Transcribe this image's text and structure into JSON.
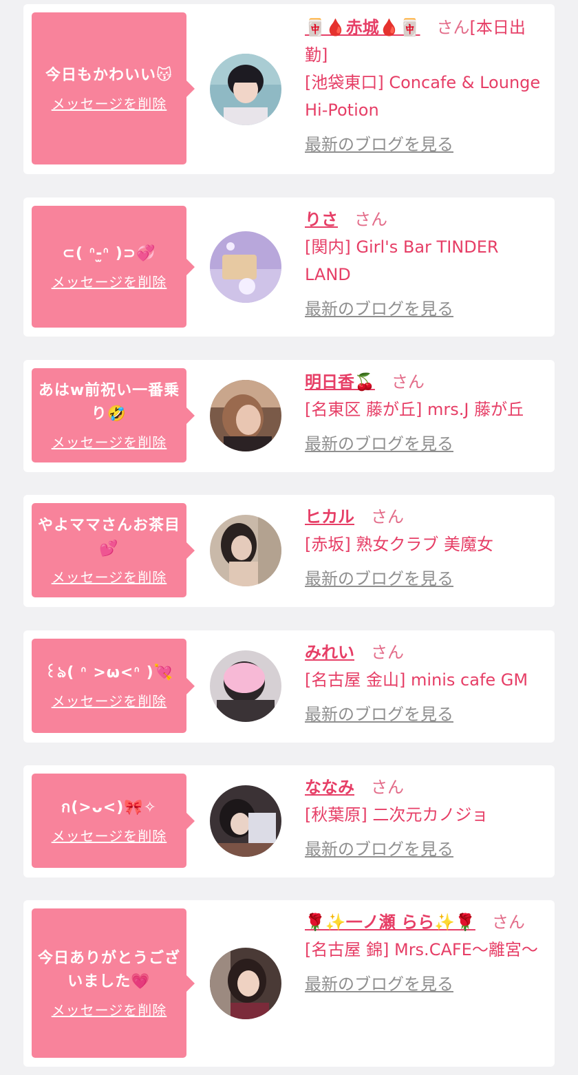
{
  "delete_label": "メッセージを削除",
  "blog_label": "最新のブログを見る",
  "honorific": "さん",
  "colors": {
    "accent": "#e63e66",
    "bubble": "#f8839b",
    "background": "#f1f1f3",
    "card": "#ffffff",
    "blog_link": "#8f8f8f"
  },
  "messages": [
    {
      "message": "今日もかわいい😽",
      "name": "🀄🩸赤城🩸🀄",
      "suffix": "[本日出勤]",
      "shop": "[池袋東口] Concafe & Lounge Hi-Potion"
    },
    {
      "message": "⊂( ᐢ-̫ᐢ )⊃💞",
      "name": "りさ",
      "suffix": "",
      "shop": "[関内] Girl's Bar TINDER LAND"
    },
    {
      "message": "あはw前祝い一番乗り🤣",
      "name": "明日香🍒",
      "suffix": "",
      "shop": "[名東区 藤が丘] mrs.J 藤が丘"
    },
    {
      "message": "やよママさんお茶目💕",
      "name": "ヒカル",
      "suffix": "",
      "shop": "[赤坂] 熟女クラブ 美魔女"
    },
    {
      "message": "꒰ঌ( ᐢ >ω<ᐢ )💘",
      "name": "みれい",
      "suffix": "",
      "shop": "[名古屋 金山] minis cafe GM"
    },
    {
      "message": "ก(>ᴗ<)🎀✧",
      "name": "ななみ",
      "suffix": "",
      "shop": "[秋葉原] 二次元カノジョ"
    },
    {
      "message": "今日ありがとうございました💗",
      "name": "🌹✨一ノ瀬 らら✨🌹",
      "suffix": "",
      "shop": "[名古屋 錦] Mrs.CAFE〜離宮〜"
    }
  ]
}
